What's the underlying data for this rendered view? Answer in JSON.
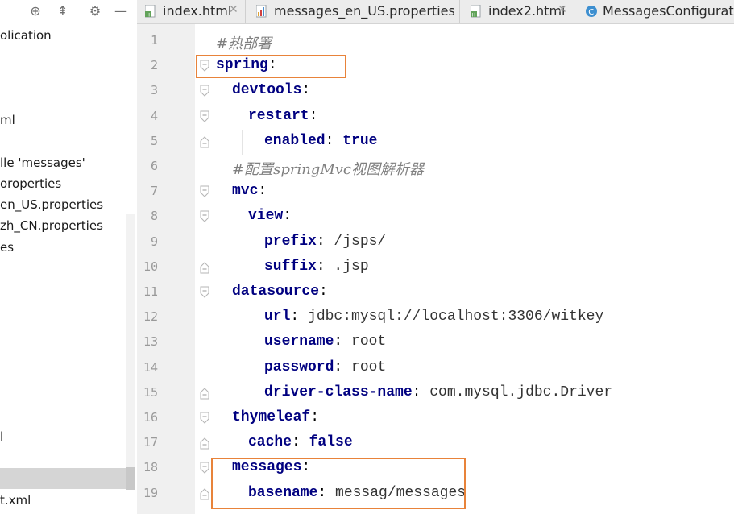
{
  "left_panel": {
    "items": [
      "olication",
      "ml",
      "lle 'messages'",
      "oroperties",
      "en_US.properties",
      "zh_CN.properties",
      "es",
      "l",
      "t.xml"
    ]
  },
  "tabs": [
    {
      "label": "index.html",
      "icon": "html-file-icon",
      "closable": true
    },
    {
      "label": "messages_en_US.properties",
      "icon": "properties-file-icon",
      "closable": true
    },
    {
      "label": "index2.html",
      "icon": "html-file-icon",
      "closable": true
    },
    {
      "label": "MessagesConfiguratio",
      "icon": "java-class-icon",
      "closable": false
    }
  ],
  "editor": {
    "lines": [
      {
        "n": "1",
        "comment": "#热部署"
      },
      {
        "n": "2",
        "key": "spring",
        "punc": ":"
      },
      {
        "n": "3",
        "key": "devtools",
        "punc": ":"
      },
      {
        "n": "4",
        "key": "restart",
        "punc": ":"
      },
      {
        "n": "5",
        "key": "enabled",
        "punc": ": ",
        "bool": "true"
      },
      {
        "n": "6",
        "comment": "#配置springMvc视图解析器"
      },
      {
        "n": "7",
        "key": "mvc",
        "punc": ":"
      },
      {
        "n": "8",
        "key": "view",
        "punc": ":"
      },
      {
        "n": "9",
        "key": "prefix",
        "punc": ": ",
        "val": "/jsps/"
      },
      {
        "n": "10",
        "key": "suffix",
        "punc": ": ",
        "val": ".jsp"
      },
      {
        "n": "11",
        "key": "datasource",
        "punc": ":"
      },
      {
        "n": "12",
        "key": "url",
        "punc": ": ",
        "val": "jdbc:mysql://localhost:3306/witkey"
      },
      {
        "n": "13",
        "key": "username",
        "punc": ": ",
        "val": "root"
      },
      {
        "n": "14",
        "key": "password",
        "punc": ": ",
        "val": "root"
      },
      {
        "n": "15",
        "key": "driver-class-name",
        "punc": ": ",
        "val": "com.mysql.jdbc.Driver"
      },
      {
        "n": "16",
        "key": "thymeleaf",
        "punc": ":"
      },
      {
        "n": "17",
        "key": "cache",
        "punc": ": ",
        "bool": "false"
      },
      {
        "n": "18",
        "key": "messages",
        "punc": ":"
      },
      {
        "n": "19",
        "key": "basename",
        "punc": ": ",
        "val": "messag/messages"
      }
    ]
  },
  "colors": {
    "highlight_box": "#e8833a",
    "key": "#000080",
    "comment": "#808080"
  }
}
